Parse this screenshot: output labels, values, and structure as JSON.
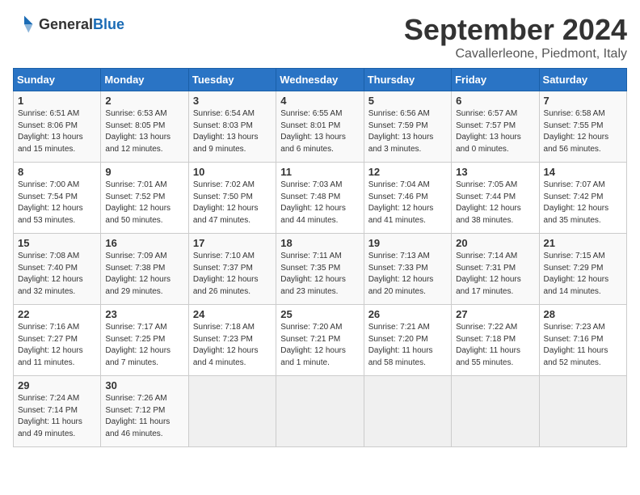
{
  "header": {
    "logo_general": "General",
    "logo_blue": "Blue",
    "month_title": "September 2024",
    "location": "Cavallerleone, Piedmont, Italy"
  },
  "weekdays": [
    "Sunday",
    "Monday",
    "Tuesday",
    "Wednesday",
    "Thursday",
    "Friday",
    "Saturday"
  ],
  "weeks": [
    [
      {
        "day": "1",
        "info": "Sunrise: 6:51 AM\nSunset: 8:06 PM\nDaylight: 13 hours\nand 15 minutes."
      },
      {
        "day": "2",
        "info": "Sunrise: 6:53 AM\nSunset: 8:05 PM\nDaylight: 13 hours\nand 12 minutes."
      },
      {
        "day": "3",
        "info": "Sunrise: 6:54 AM\nSunset: 8:03 PM\nDaylight: 13 hours\nand 9 minutes."
      },
      {
        "day": "4",
        "info": "Sunrise: 6:55 AM\nSunset: 8:01 PM\nDaylight: 13 hours\nand 6 minutes."
      },
      {
        "day": "5",
        "info": "Sunrise: 6:56 AM\nSunset: 7:59 PM\nDaylight: 13 hours\nand 3 minutes."
      },
      {
        "day": "6",
        "info": "Sunrise: 6:57 AM\nSunset: 7:57 PM\nDaylight: 13 hours\nand 0 minutes."
      },
      {
        "day": "7",
        "info": "Sunrise: 6:58 AM\nSunset: 7:55 PM\nDaylight: 12 hours\nand 56 minutes."
      }
    ],
    [
      {
        "day": "8",
        "info": "Sunrise: 7:00 AM\nSunset: 7:54 PM\nDaylight: 12 hours\nand 53 minutes."
      },
      {
        "day": "9",
        "info": "Sunrise: 7:01 AM\nSunset: 7:52 PM\nDaylight: 12 hours\nand 50 minutes."
      },
      {
        "day": "10",
        "info": "Sunrise: 7:02 AM\nSunset: 7:50 PM\nDaylight: 12 hours\nand 47 minutes."
      },
      {
        "day": "11",
        "info": "Sunrise: 7:03 AM\nSunset: 7:48 PM\nDaylight: 12 hours\nand 44 minutes."
      },
      {
        "day": "12",
        "info": "Sunrise: 7:04 AM\nSunset: 7:46 PM\nDaylight: 12 hours\nand 41 minutes."
      },
      {
        "day": "13",
        "info": "Sunrise: 7:05 AM\nSunset: 7:44 PM\nDaylight: 12 hours\nand 38 minutes."
      },
      {
        "day": "14",
        "info": "Sunrise: 7:07 AM\nSunset: 7:42 PM\nDaylight: 12 hours\nand 35 minutes."
      }
    ],
    [
      {
        "day": "15",
        "info": "Sunrise: 7:08 AM\nSunset: 7:40 PM\nDaylight: 12 hours\nand 32 minutes."
      },
      {
        "day": "16",
        "info": "Sunrise: 7:09 AM\nSunset: 7:38 PM\nDaylight: 12 hours\nand 29 minutes."
      },
      {
        "day": "17",
        "info": "Sunrise: 7:10 AM\nSunset: 7:37 PM\nDaylight: 12 hours\nand 26 minutes."
      },
      {
        "day": "18",
        "info": "Sunrise: 7:11 AM\nSunset: 7:35 PM\nDaylight: 12 hours\nand 23 minutes."
      },
      {
        "day": "19",
        "info": "Sunrise: 7:13 AM\nSunset: 7:33 PM\nDaylight: 12 hours\nand 20 minutes."
      },
      {
        "day": "20",
        "info": "Sunrise: 7:14 AM\nSunset: 7:31 PM\nDaylight: 12 hours\nand 17 minutes."
      },
      {
        "day": "21",
        "info": "Sunrise: 7:15 AM\nSunset: 7:29 PM\nDaylight: 12 hours\nand 14 minutes."
      }
    ],
    [
      {
        "day": "22",
        "info": "Sunrise: 7:16 AM\nSunset: 7:27 PM\nDaylight: 12 hours\nand 11 minutes."
      },
      {
        "day": "23",
        "info": "Sunrise: 7:17 AM\nSunset: 7:25 PM\nDaylight: 12 hours\nand 7 minutes."
      },
      {
        "day": "24",
        "info": "Sunrise: 7:18 AM\nSunset: 7:23 PM\nDaylight: 12 hours\nand 4 minutes."
      },
      {
        "day": "25",
        "info": "Sunrise: 7:20 AM\nSunset: 7:21 PM\nDaylight: 12 hours\nand 1 minute."
      },
      {
        "day": "26",
        "info": "Sunrise: 7:21 AM\nSunset: 7:20 PM\nDaylight: 11 hours\nand 58 minutes."
      },
      {
        "day": "27",
        "info": "Sunrise: 7:22 AM\nSunset: 7:18 PM\nDaylight: 11 hours\nand 55 minutes."
      },
      {
        "day": "28",
        "info": "Sunrise: 7:23 AM\nSunset: 7:16 PM\nDaylight: 11 hours\nand 52 minutes."
      }
    ],
    [
      {
        "day": "29",
        "info": "Sunrise: 7:24 AM\nSunset: 7:14 PM\nDaylight: 11 hours\nand 49 minutes."
      },
      {
        "day": "30",
        "info": "Sunrise: 7:26 AM\nSunset: 7:12 PM\nDaylight: 11 hours\nand 46 minutes."
      },
      {
        "day": "",
        "info": ""
      },
      {
        "day": "",
        "info": ""
      },
      {
        "day": "",
        "info": ""
      },
      {
        "day": "",
        "info": ""
      },
      {
        "day": "",
        "info": ""
      }
    ]
  ]
}
